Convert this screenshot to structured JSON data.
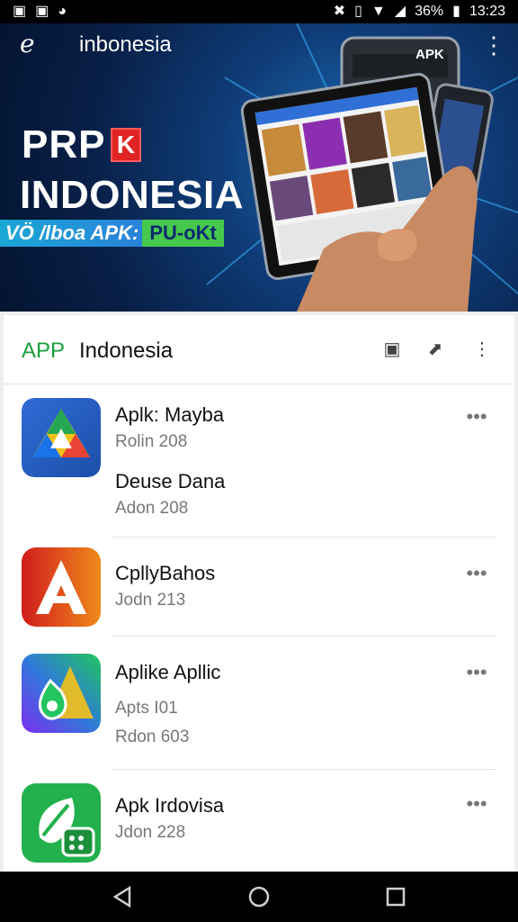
{
  "status_bar": {
    "left_icons": [
      "image-icon",
      "image-icon",
      "moon-icon"
    ],
    "right_icons": [
      "silent-icon",
      "vibrate-icon",
      "wifi-icon",
      "signal-icon"
    ],
    "battery": "36%",
    "time": "13:23"
  },
  "hero": {
    "title": "inbonesia",
    "brand_line1": "PRP",
    "brand_badge": "K",
    "brand_line2": "INDONESIA",
    "tag_blue": "VÖ /lboa APK:",
    "tag_green": "PU-oKt",
    "device_badge": "APK"
  },
  "panel": {
    "accent": "APP",
    "title": "Indonesia"
  },
  "apps": [
    {
      "title": "Aplk: Mayba",
      "sub": "Rolin 208",
      "title2": "Deuse Dana",
      "sub2": "Adon 208",
      "icon": "drive-triangle-icon"
    },
    {
      "title": "CpllyBahos",
      "sub": "Jodn 213",
      "icon": "red-a-icon"
    },
    {
      "title": "Aplike Apllic",
      "sub": "Apts I01",
      "sub2": "Rdon 603",
      "icon": "drop-icon"
    },
    {
      "title": "Apk Irdovisa",
      "sub": "Jdon 228",
      "icon": "leaf-chat-icon"
    }
  ],
  "colors": {
    "accent_green": "#1a9f3b",
    "hero_blue": "#0f3c78",
    "tag_blue": "#2a82d9",
    "tag_green": "#46c84c"
  }
}
